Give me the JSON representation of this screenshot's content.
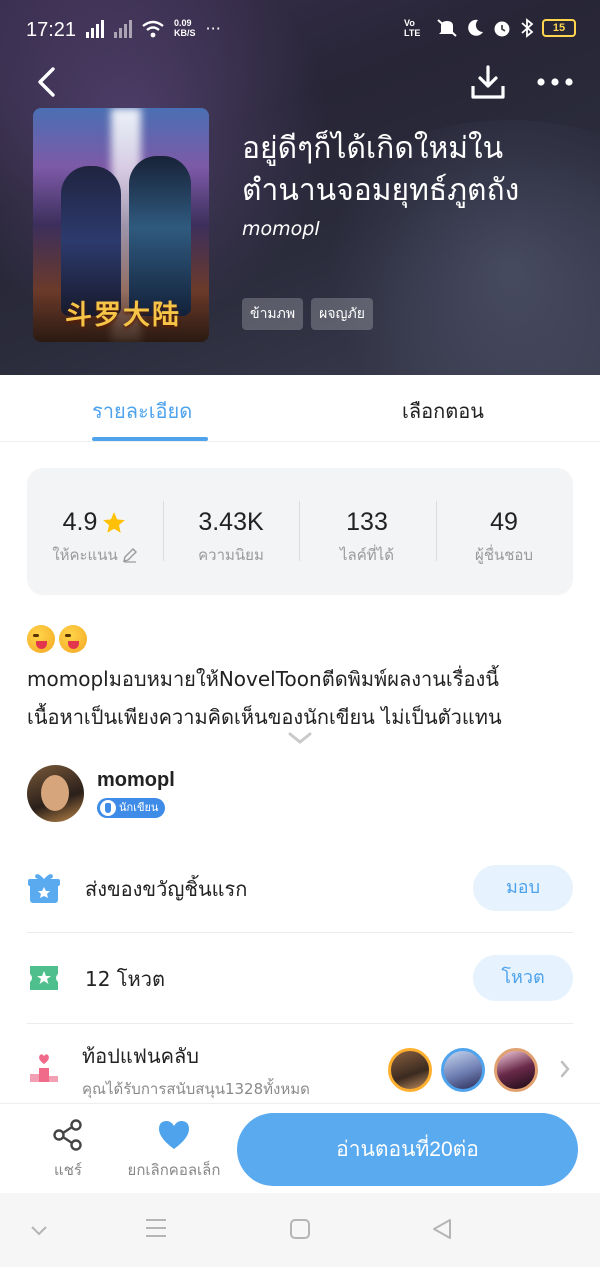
{
  "status_bar": {
    "time": "17:21",
    "speed_value": "0.09",
    "speed_unit": "KB/S",
    "more": "···",
    "network_label": "Vo LTE",
    "battery": "15"
  },
  "hero": {
    "title": "อยู่ดีๆก็ได้เกิดใหม่ในตำนานจอมยุทธ์ภูตถัง",
    "author": "momopl",
    "tags": [
      "ข้ามภพ",
      "ผจญภัย"
    ],
    "cover_title": "斗罗大陆"
  },
  "tabs": [
    {
      "label": "รายละเอียด",
      "active": true
    },
    {
      "label": "เลือกตอน",
      "active": false
    }
  ],
  "stats": [
    {
      "value": "4.9",
      "label": "ให้คะแนน"
    },
    {
      "value": "3.43K",
      "label": "ความนิยม"
    },
    {
      "value": "133",
      "label": "ไลค์ที่ได้"
    },
    {
      "value": "49",
      "label": "ผู้ชื่นชอบ"
    }
  ],
  "description": {
    "line1": "momoplมอบหมายให้NovelToonตีดพิมพ์ผลงานเรื่องนี้",
    "line2": "เนื้อหาเป็นเพียงความคิดเห็นของนักเขียน ไม่เป็นตัวแทน"
  },
  "author_card": {
    "name": "momopl",
    "badge": "นักเขียน"
  },
  "gift_row": {
    "label": "ส่งของขวัญชิ้นแรก",
    "button": "มอบ"
  },
  "vote_row": {
    "label": "12 โหวต",
    "button": "โหวต"
  },
  "fanclub": {
    "title": "ท้อปแฟนคลับ",
    "subtitle": "คุณได้รับการสนับสนุน1328ทั้งหมด"
  },
  "bottom_bar": {
    "share": "แชร์",
    "uncollect": "ยกเลิกคอลเล็ก",
    "read_button": "อ่านตอนที่20ต่อ"
  },
  "colors": {
    "accent": "#4ea3ec",
    "read_button": "#5aaaf0",
    "heart": "#4ea3ec",
    "star": "#ffc107"
  }
}
